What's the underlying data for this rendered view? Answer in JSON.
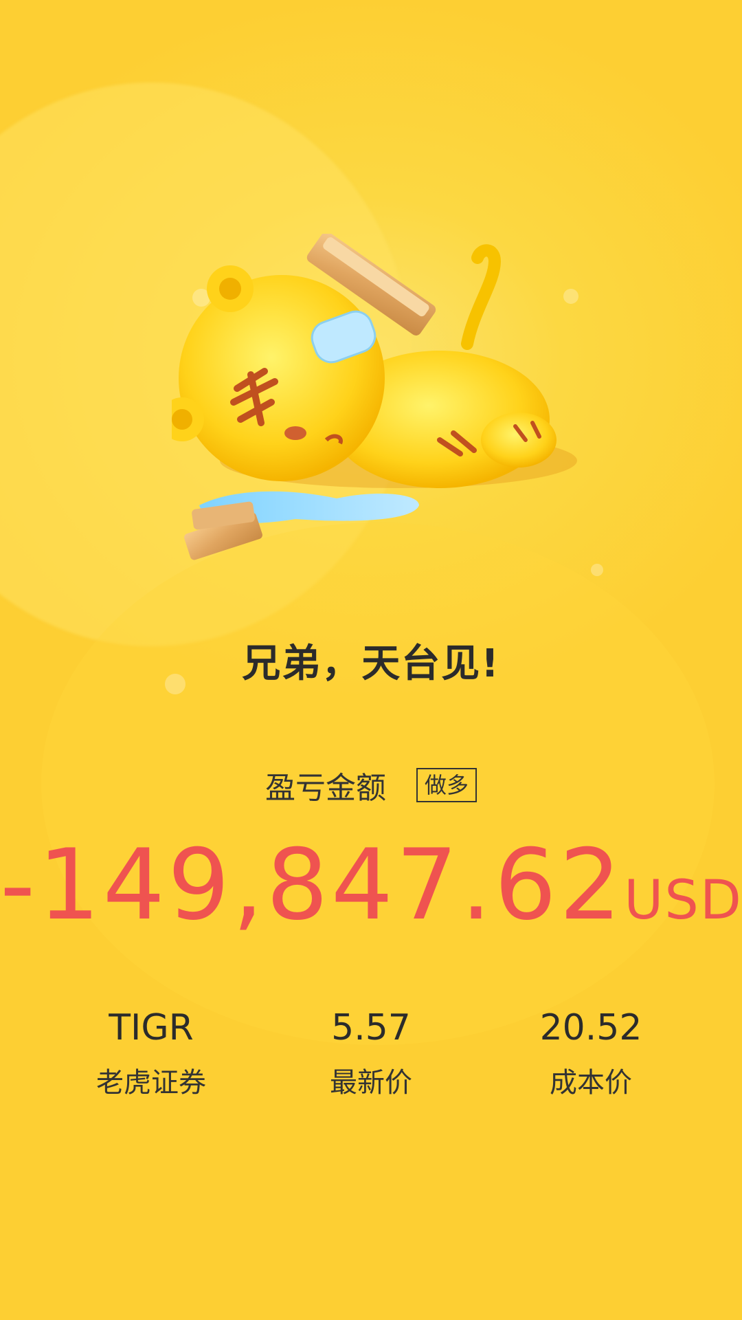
{
  "headline": "兄弟，天台见!",
  "pnl": {
    "label": "盈亏金额",
    "tag": "做多",
    "amount": "-149,847.62",
    "unit": "USD"
  },
  "stats": [
    {
      "value": "TIGR",
      "label": "老虎证券"
    },
    {
      "value": "5.57",
      "label": "最新价"
    },
    {
      "value": "20.52",
      "label": "成本价"
    }
  ],
  "colors": {
    "background": "#fdd43b",
    "loss": "#ef5350",
    "text": "#2b2b2b"
  },
  "illustration": "crying-tiger-with-gold-bars"
}
